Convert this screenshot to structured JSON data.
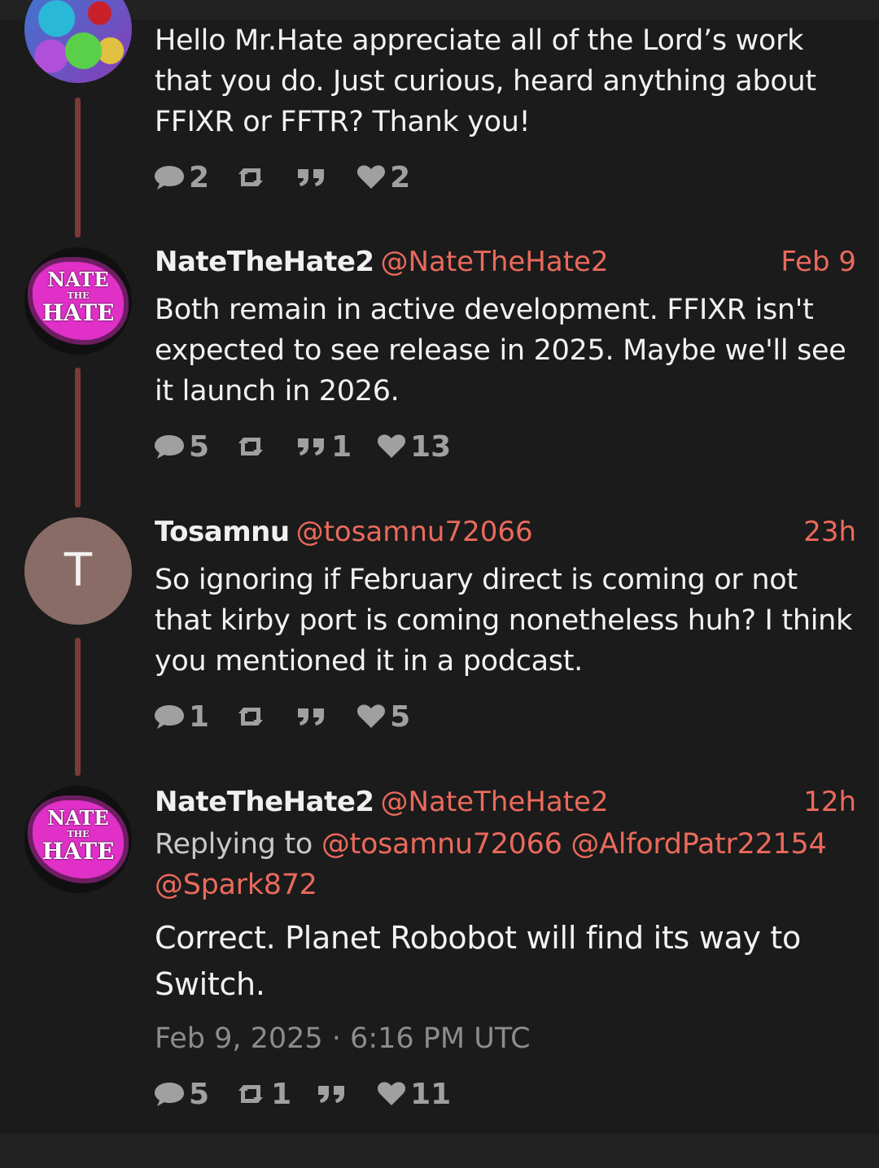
{
  "tweets": [
    {
      "body": "Hello Mr.Hate appreciate all of the Lord’s work that you do. Just curious, heard anything about FFIXR or FFTR? Thank you!",
      "stats": {
        "replies": "2",
        "retweets": "",
        "quotes": "",
        "likes": "2"
      }
    },
    {
      "name": "NateTheHate2",
      "handle": "@NateTheHate2",
      "time": "Feb 9",
      "body": "Both remain in active development. FFIXR isn't expected to see release in 2025. Maybe we'll see it launch in 2026.",
      "stats": {
        "replies": "5",
        "retweets": "",
        "quotes": "1",
        "likes": "13"
      }
    },
    {
      "name": "Tosamnu",
      "handle": "@tosamnu72066",
      "time": "23h",
      "avatar_letter": "T",
      "body": "So ignoring if February direct is coming or not that kirby port is coming nonetheless huh? I think you mentioned it in a podcast.",
      "stats": {
        "replies": "1",
        "retweets": "",
        "quotes": "",
        "likes": "5"
      }
    },
    {
      "name": "NateTheHate2",
      "handle": "@NateTheHate2",
      "time": "12h",
      "replying_prefix": "Replying to",
      "replying_to": [
        "@tosamnu72066",
        "@AlfordPatr22154",
        "@Spark872"
      ],
      "body": "Correct. Planet Robobot will find its way to Switch.",
      "datestamp": "Feb 9, 2025 · 6:16 PM UTC",
      "stats": {
        "replies": "5",
        "retweets": "1",
        "quotes": "",
        "likes": "11"
      }
    }
  ],
  "avatar_logo": {
    "line1": "NATE",
    "line2": "THE",
    "line3": "HATE"
  },
  "icons": {
    "reply": "comment-bubble-icon",
    "retweet": "retweet-icon",
    "quote": "quote-icon",
    "like": "heart-icon"
  },
  "colors": {
    "background": "#1b1b1b",
    "accent": "#ea6a5c",
    "thread_line": "#7a3a36",
    "stat_gray": "#a0a0a0"
  }
}
